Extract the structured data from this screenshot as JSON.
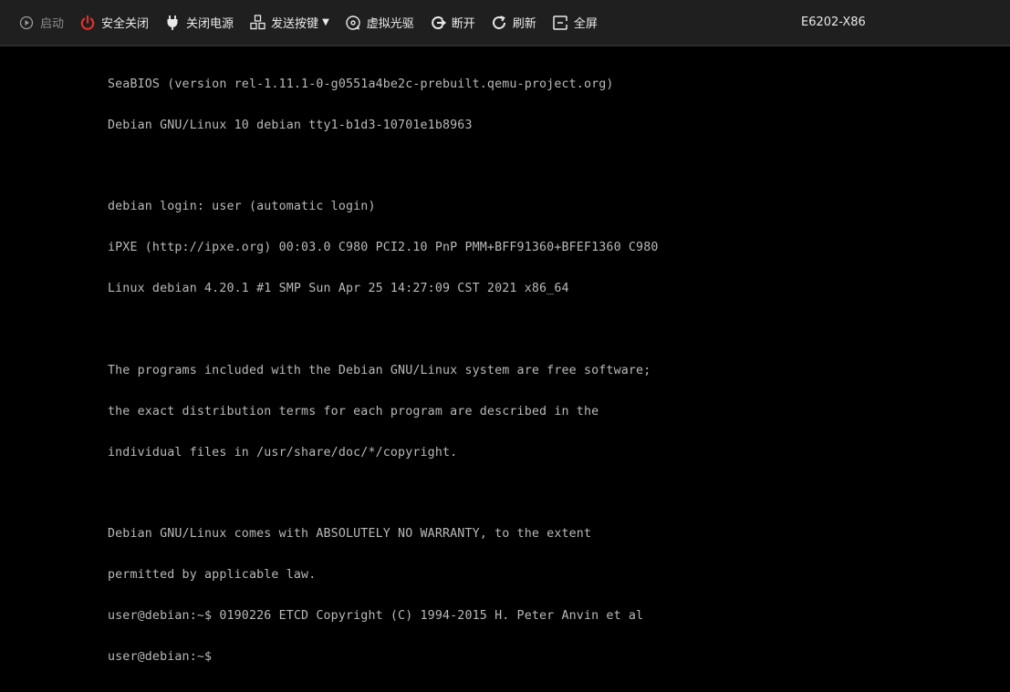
{
  "toolbar": {
    "items": [
      {
        "label": "启动",
        "icon": "play-circle-icon",
        "enabled": false
      },
      {
        "label": "安全关闭",
        "icon": "power-icon",
        "enabled": true
      },
      {
        "label": "关闭电源",
        "icon": "plug-icon",
        "enabled": true
      },
      {
        "label": "发送按键",
        "icon": "keyboard-icon",
        "enabled": true,
        "dropdown": true
      },
      {
        "label": "虚拟光驱",
        "icon": "disc-icon",
        "enabled": true
      },
      {
        "label": "断开",
        "icon": "disconnect-icon",
        "enabled": true
      },
      {
        "label": "刷新",
        "icon": "refresh-icon",
        "enabled": true
      },
      {
        "label": "全屏",
        "icon": "fullscreen-icon",
        "enabled": true
      }
    ],
    "host": "E6202-X86"
  },
  "colors": {
    "toolbar_bg": "#1f1f1f",
    "power_icon": "#e0302a",
    "terminal_bg": "#000000",
    "terminal_fg": "#b9b9b9"
  },
  "terminal": {
    "lines": [
      "SeaBIOS (version rel-1.11.1-0-g0551a4be2c-prebuilt.qemu-project.org)",
      "Debian GNU/Linux 10 debian tty1-b1d3-10701e1b8963",
      "",
      "debian login: user (automatic login)",
      "iPXE (http://ipxe.org) 00:03.0 C980 PCI2.10 PnP PMM+BFF91360+BFEF1360 C980",
      "Linux debian 4.20.1 #1 SMP Sun Apr 25 14:27:09 CST 2021 x86_64",
      "",
      "The programs included with the Debian GNU/Linux system are free software;",
      "the exact distribution terms for each program are described in the",
      "individual files in /usr/share/doc/*/copyright.",
      "",
      "Debian GNU/Linux comes with ABSOLUTELY NO WARRANTY, to the extent",
      "permitted by applicable law.",
      "user@debian:~$ 0190226 ETCD Copyright (C) 1994-2015 H. Peter Anvin et al",
      "user@debian:~$"
    ]
  }
}
